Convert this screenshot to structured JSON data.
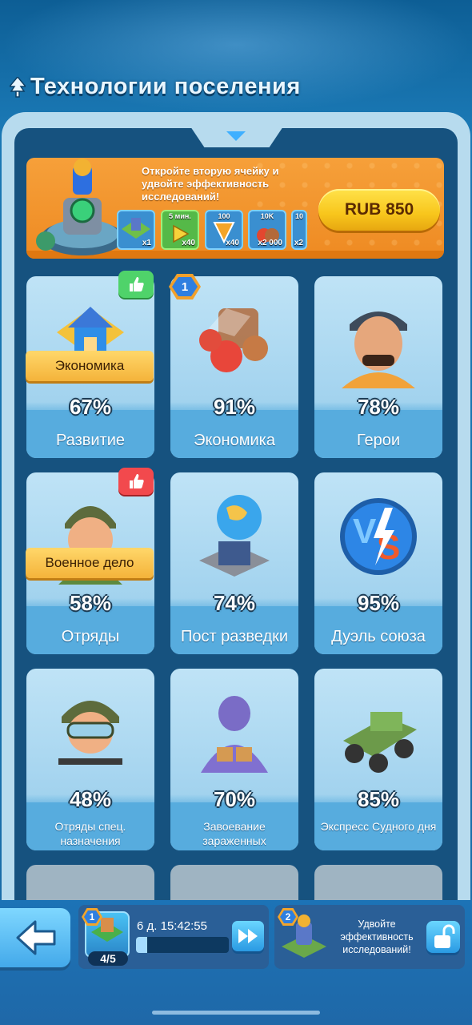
{
  "header": {
    "title": "Технологии поселения"
  },
  "promo": {
    "text": "Откройте вторую ячейку и удвойте эффективность исследований!",
    "price": "RUB 850",
    "rewards": [
      {
        "top": "",
        "qty": "x1"
      },
      {
        "top": "5 мин.",
        "qty": "x40"
      },
      {
        "top": "100",
        "qty": "x40"
      },
      {
        "top": "10K",
        "qty": "x2 000"
      },
      {
        "top": "10",
        "qty": "x2"
      }
    ]
  },
  "cards": [
    {
      "name": "Развитие",
      "percent": "67%",
      "ribbon": "Экономика",
      "badge": "thumbs-up-green"
    },
    {
      "name": "Экономика",
      "percent": "91%",
      "badge_number": "1"
    },
    {
      "name": "Герои",
      "percent": "78%"
    },
    {
      "name": "Отряды",
      "percent": "58%",
      "ribbon": "Военное дело",
      "badge": "thumbs-up-red"
    },
    {
      "name": "Пост разведки",
      "percent": "74%"
    },
    {
      "name": "Дуэль союза",
      "percent": "95%"
    },
    {
      "name": "Отряды спец. назначения",
      "percent": "48%"
    },
    {
      "name": "Завоевание зараженных",
      "percent": "70%"
    },
    {
      "name": "Экспресс Судного дня",
      "percent": "85%"
    }
  ],
  "research_queue": {
    "slot1_number": "1",
    "count": "4/5",
    "timer": "6 д. 15:42:55",
    "progress": 0.12,
    "slot2_number": "2",
    "slot2_text": "Удвойте эффективность исследований!"
  },
  "colors": {
    "accent": "#f4b33a",
    "panel": "#16527f",
    "card": "#a8d6f0"
  }
}
